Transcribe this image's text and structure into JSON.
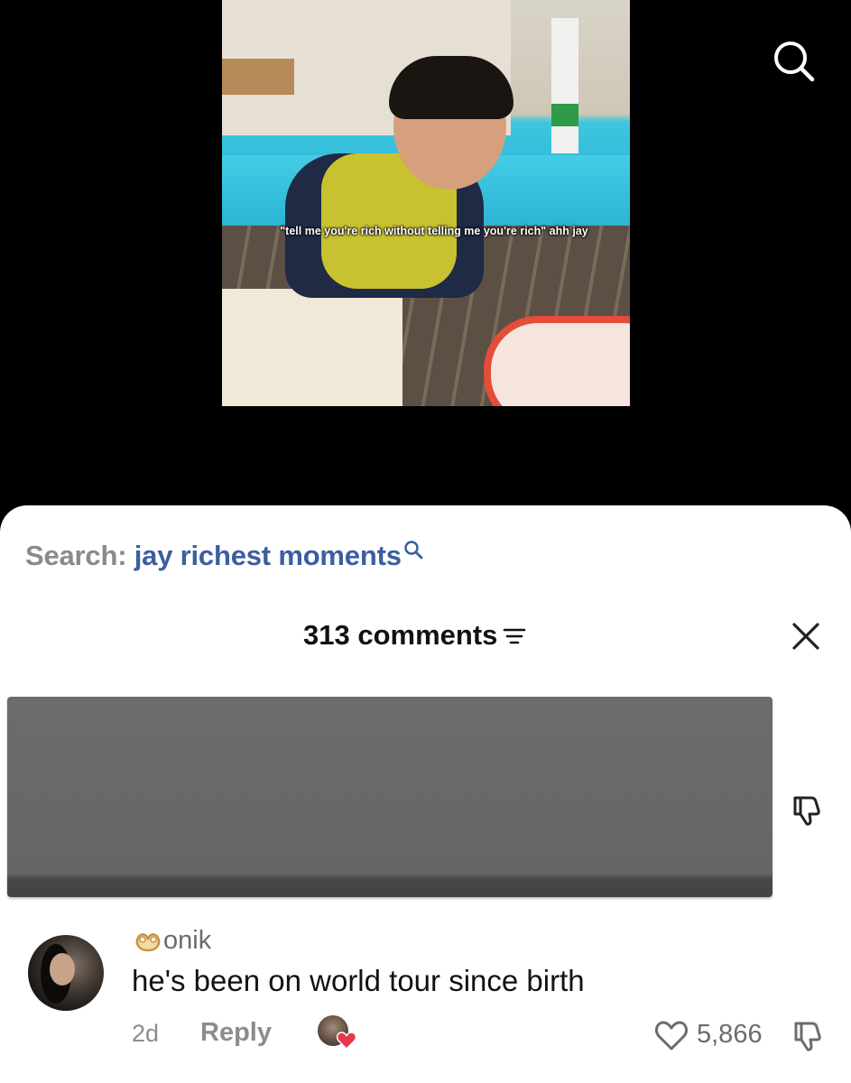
{
  "video": {
    "overlay_caption": "\"tell me you're rich without telling me you're rich\" ahh jay"
  },
  "top_bar": {
    "search_icon": "search-icon"
  },
  "search": {
    "label": "Search: ",
    "term": "jay richest moments",
    "icon": "search-icon"
  },
  "comments": {
    "header": "313 comments",
    "sort_icon": "filter-lines-icon",
    "close_icon": "close-icon"
  },
  "items": [
    {
      "username": "onik",
      "badge_icon": "pretzel-icon",
      "text": "he's been on world tour since birth",
      "time": "2d",
      "reply_label": "Reply",
      "likes": "5,866",
      "creator_liked": true
    }
  ],
  "colors": {
    "accent_blue": "#3c5ea0",
    "heart_red": "#e5394b",
    "muted_gray": "#8b8b90"
  }
}
